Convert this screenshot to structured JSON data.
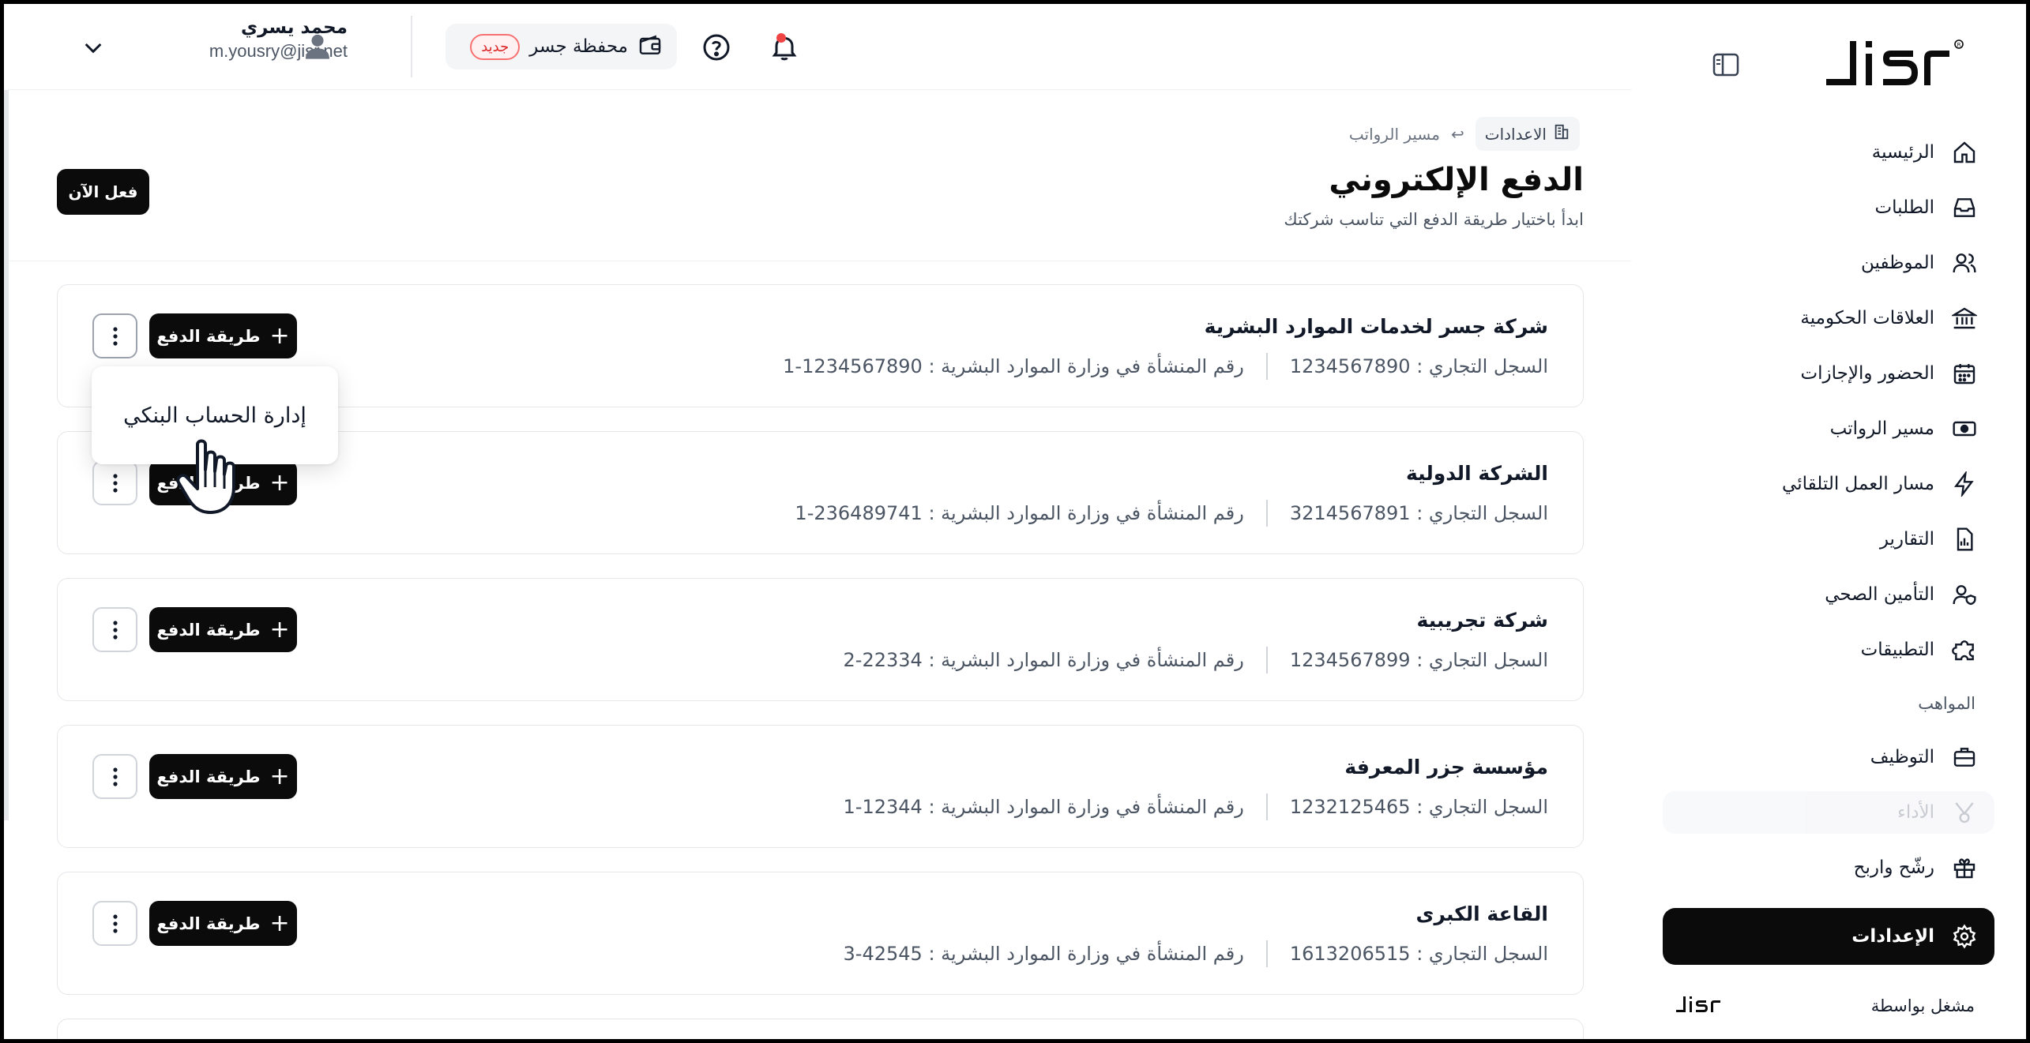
{
  "sidebar": {
    "brand": "JISR",
    "items": [
      {
        "label": "الرئيسية",
        "icon": "home-icon"
      },
      {
        "label": "الطلبات",
        "icon": "inbox-icon"
      },
      {
        "label": "الموظفين",
        "icon": "users-icon"
      },
      {
        "label": "العلاقات الحكومية",
        "icon": "bank-icon"
      },
      {
        "label": "الحضور والإجازات",
        "icon": "calendar-icon"
      },
      {
        "label": "مسير الرواتب",
        "icon": "money-icon"
      },
      {
        "label": "مسار العمل التلقائي",
        "icon": "automation-icon"
      },
      {
        "label": "التقارير",
        "icon": "report-icon"
      },
      {
        "label": "التأمين الصحي",
        "icon": "health-insurance-icon"
      },
      {
        "label": "التطبيقات",
        "icon": "puzzle-icon"
      }
    ],
    "section_talent": "المواهب",
    "talent_items": [
      {
        "label": "التوظيف",
        "icon": "briefcase-icon"
      },
      {
        "label": "الأداء",
        "icon": "performance-icon"
      },
      {
        "label": "رشّح واربح",
        "icon": "gift-icon"
      }
    ],
    "active_item": {
      "label": "الإعدادات",
      "icon": "gear-icon"
    },
    "powered_by": "مشغل بواسطة",
    "powered_brand": "JISR"
  },
  "topbar": {
    "wallet_label": "محفظة جسر",
    "wallet_badge": "جديد",
    "user_name": "محمد يسري",
    "user_email": "m.yousry@jisr.net"
  },
  "breadcrumb": {
    "parent": "الاعدادات",
    "separator": "↩",
    "current": "مسير الرواتب"
  },
  "page": {
    "title": "الدفع الإلكتروني",
    "subtitle": "ابدأ باختيار طريقة الدفع التي تناسب شركتك",
    "cta": "فعل الآن"
  },
  "labels": {
    "cr": "السجل التجاري :",
    "mol": "رقم المنشأة في وزارة الموارد البشرية :",
    "pay_method": "طريقة الدفع",
    "plus": "+"
  },
  "companies": [
    {
      "name": "شركة جسر لخدمات الموارد البشرية",
      "cr": "1234567890",
      "mol": "1234567890-1"
    },
    {
      "name": "الشركة الدولية",
      "cr": "3214567891",
      "mol": "236489741-1"
    },
    {
      "name": "شركة تجريبية",
      "cr": "1234567899",
      "mol": "22334-2"
    },
    {
      "name": "مؤسسة جزر المعرفة",
      "cr": "1232125465",
      "mol": "12344-1"
    },
    {
      "name": "القاعة الكبرى",
      "cr": "1613206515",
      "mol": "42545-3"
    }
  ],
  "menu": {
    "item": "إدارة الحساب البنكي"
  },
  "colors": {
    "primary": "#0b0b0b",
    "badge_red": "#dc2626",
    "notification_dot": "#ef4444"
  }
}
